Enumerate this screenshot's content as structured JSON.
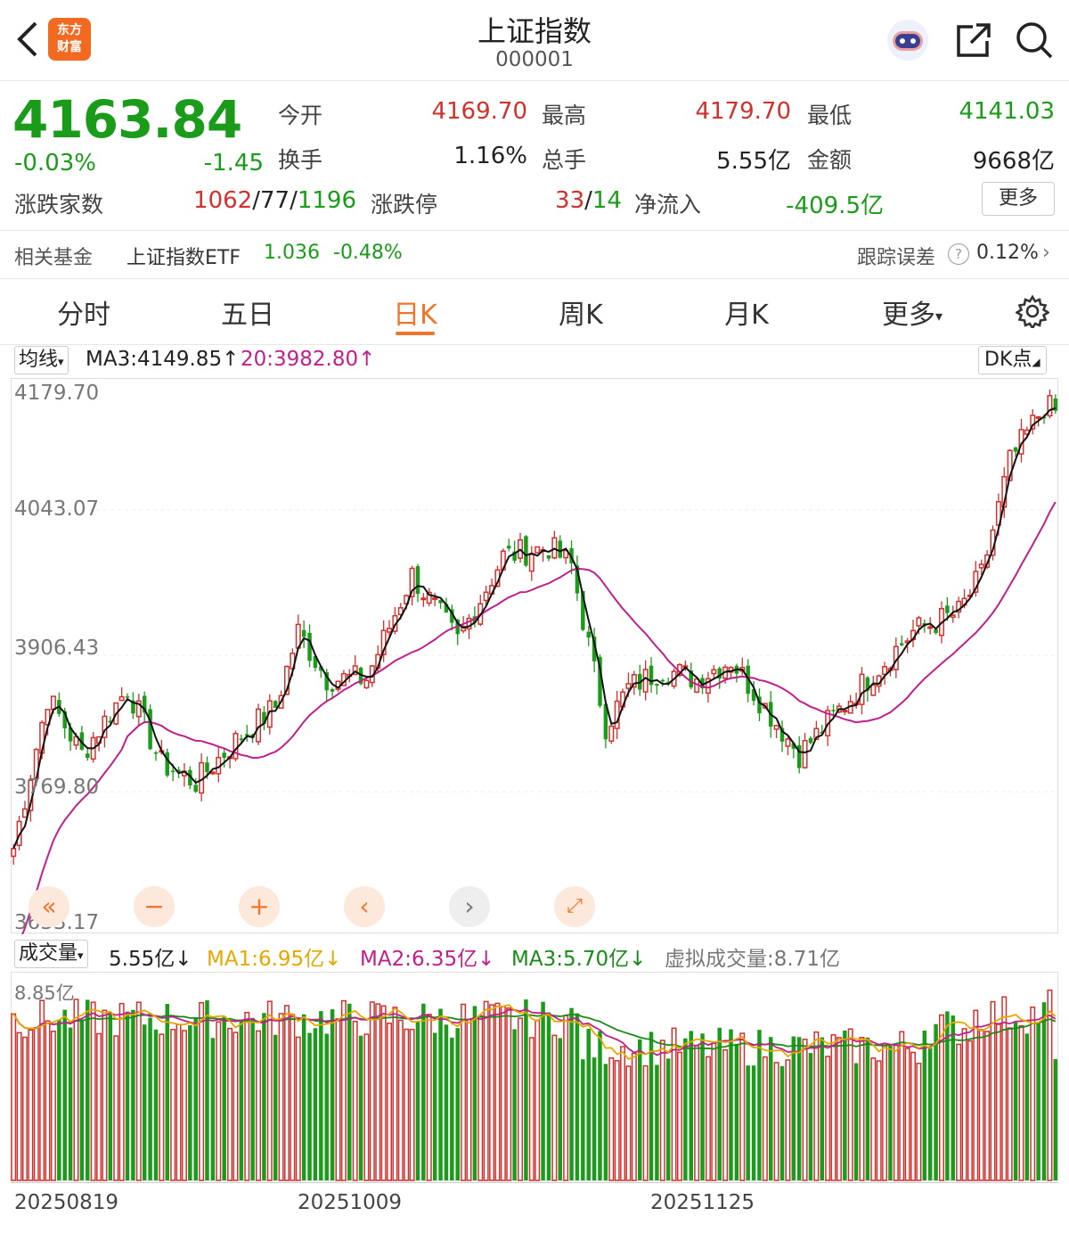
{
  "header": {
    "title": "上证指数",
    "code": "000001",
    "logo_line1": "东方",
    "logo_line2": "财富"
  },
  "quote": {
    "price": "4163.84",
    "change_pct": "-0.03%",
    "change": "-1.45",
    "open_label": "今开",
    "open": "4169.70",
    "high_label": "最高",
    "high": "4179.70",
    "low_label": "最低",
    "low": "4141.03",
    "turnover_label": "换手",
    "turnover": "1.16%",
    "volume_label": "总手",
    "volume": "5.55亿",
    "amount_label": "金额",
    "amount": "9668亿",
    "breadth_label": "涨跌家数",
    "breadth_up": "1062",
    "breadth_flat": "77",
    "breadth_down": "1196",
    "limit_label": "涨跌停",
    "limit_up": "33",
    "limit_down": "14",
    "inflow_label": "净流入",
    "inflow": "-409.5亿",
    "more_label": "更多",
    "sep": "/"
  },
  "fund": {
    "label": "相关基金",
    "name": "上证指数ETF",
    "price": "1.036",
    "change": "-0.48%",
    "tracking_label": "跟踪误差",
    "tracking_value": "0.12%"
  },
  "tabs": [
    "分时",
    "五日",
    "日K",
    "周K",
    "月K",
    "更多"
  ],
  "active_tab": 2,
  "kline": {
    "ma_select": "均线",
    "ma3_text": "MA3:4149.85↑",
    "ma20_text": "20:3982.80↑",
    "dk_label": "DK点",
    "y_labels": [
      "4179.70",
      "4043.07",
      "3906.43",
      "3769.80",
      "3633.17"
    ]
  },
  "volume_panel": {
    "select": "成交量",
    "vol_text": "5.55亿↓",
    "ma1_text": "MA1:6.95亿↓",
    "ma2_text": "MA2:6.35亿↓",
    "ma3_text": "MA3:5.70亿↓",
    "virtual_text": "虚拟成交量:8.71亿",
    "y_label": "8.85亿",
    "x_labels": [
      "20250819",
      "20251009",
      "20251125"
    ]
  },
  "colors": {
    "up": "#d0312d",
    "down": "#1a9b1a",
    "ma_fast": "#111111",
    "ma_slow": "#c0208a",
    "vol_ma1": "#e6a800",
    "vol_ma2": "#c0208a",
    "vol_ma3": "#1a8a1a",
    "accent": "#f0742a"
  }
}
